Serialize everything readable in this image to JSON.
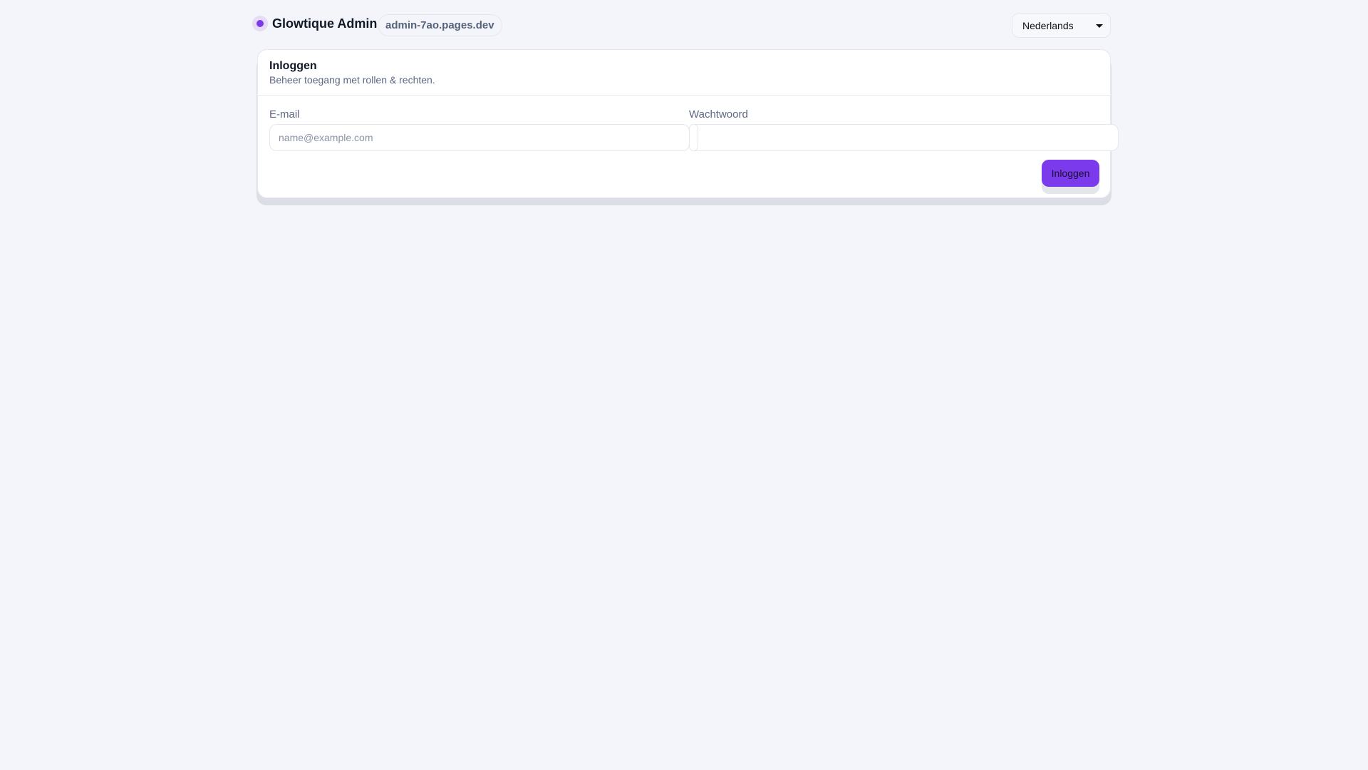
{
  "header": {
    "app_name": "Glowtique Admin",
    "domain_badge": "admin-7ao.pages.dev",
    "language": "Nederlands"
  },
  "card": {
    "title": "Inloggen",
    "subtitle": "Beheer toegang met rollen & rechten.",
    "email_label": "E-mail",
    "email_placeholder": "name@example.com",
    "password_label": "Wachtwoord",
    "submit_label": "Inloggen"
  },
  "colors": {
    "accent": "#7c3aed"
  }
}
